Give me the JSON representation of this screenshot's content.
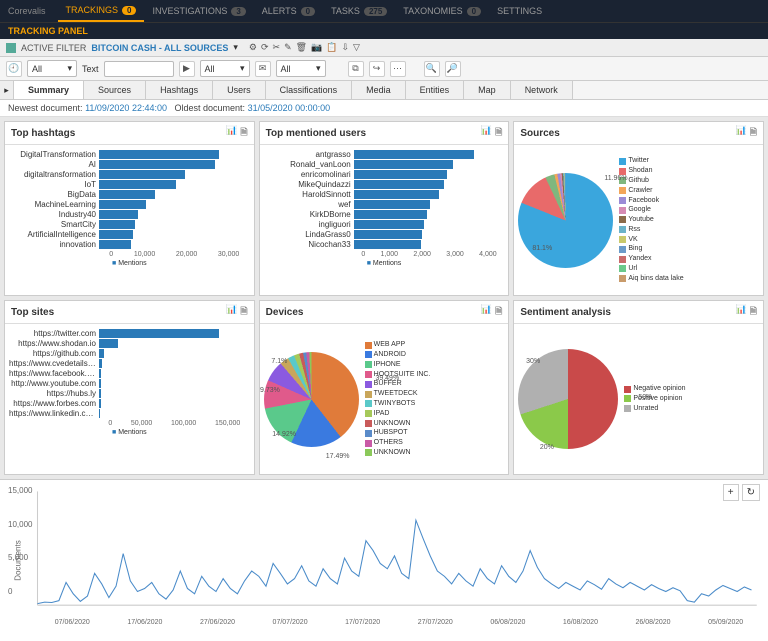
{
  "brand": "Corevalis",
  "nav": [
    {
      "label": "TRACKINGS",
      "badge": "0",
      "active": true
    },
    {
      "label": "INVESTIGATIONS",
      "badge": "3"
    },
    {
      "label": "ALERTS",
      "badge": "0"
    },
    {
      "label": "TASKS",
      "badge": "275"
    },
    {
      "label": "TAXONOMIES",
      "badge": "0"
    },
    {
      "label": "SETTINGS"
    }
  ],
  "panel_header": "TRACKING PANEL",
  "filter": {
    "label": "ACTIVE FILTER",
    "value": "BITCOIN CASH - ALL SOURCES"
  },
  "toolbar": {
    "sel_all": "All",
    "text_label": "Text",
    "text_value": "",
    "sel_all2": "All",
    "sel_all3": "All"
  },
  "tabs": [
    "Summary",
    "Sources",
    "Hashtags",
    "Users",
    "Classifications",
    "Media",
    "Entities",
    "Map",
    "Network"
  ],
  "active_tab": "Summary",
  "info": {
    "newest_lbl": "Newest document:",
    "newest": "11/09/2020 22:44:00",
    "oldest_lbl": "Oldest document:",
    "oldest": "31/05/2020 00:00:00"
  },
  "cards": {
    "hashtags": {
      "title": "Top hashtags",
      "legend": "Mentions"
    },
    "users": {
      "title": "Top mentioned users",
      "legend": "Mentions"
    },
    "sources": {
      "title": "Sources"
    },
    "sites": {
      "title": "Top sites",
      "legend": "Mentions"
    },
    "devices": {
      "title": "Devices"
    },
    "sentiment": {
      "title": "Sentiment analysis"
    }
  },
  "timeline": {
    "ylabel": "Documents"
  },
  "chart_data": [
    {
      "type": "bar",
      "id": "hashtags",
      "orientation": "h",
      "xlabel": "Mentions",
      "xticks": [
        0,
        10000,
        20000,
        30000
      ],
      "categories": [
        "DigitalTransformation",
        "AI",
        "digitaltransformation",
        "IoT",
        "BigData",
        "MachineLearning",
        "Industry40",
        "SmartCity",
        "ArtificialIntelligence",
        "innovation"
      ],
      "values": [
        28000,
        27000,
        20000,
        18000,
        13000,
        11000,
        9000,
        8500,
        8000,
        7500
      ]
    },
    {
      "type": "bar",
      "id": "users",
      "orientation": "h",
      "xlabel": "Mentions",
      "xticks": [
        0,
        1000,
        2000,
        3000,
        4000
      ],
      "categories": [
        "antgrasso",
        "Ronald_vanLoon",
        "enricomolinari",
        "MikeQuindazzi",
        "HaroldSinnott",
        "wef",
        "KirkDBorne",
        "ingliguori",
        "LindaGrass0",
        "Nicochan33"
      ],
      "values": [
        4100,
        3400,
        3200,
        3100,
        2900,
        2600,
        2500,
        2400,
        2350,
        2300
      ]
    },
    {
      "type": "pie",
      "id": "sources",
      "series": [
        {
          "name": "Twitter",
          "value": 81.1,
          "color": "#3aa6dd"
        },
        {
          "name": "Shodan",
          "value": 11.96,
          "color": "#e86a6a"
        },
        {
          "name": "Github",
          "value": 3.15,
          "color": "#7fb77e"
        },
        {
          "name": "Crawler",
          "value": 0.99,
          "color": "#f2a65a"
        },
        {
          "name": "Facebook",
          "value": 0.92,
          "color": "#9b8bd6"
        },
        {
          "name": "Google",
          "value": 0.59,
          "color": "#d68bb3"
        },
        {
          "name": "Youtube",
          "value": 0.49,
          "color": "#8b6b4a"
        },
        {
          "name": "Rss",
          "value": 0.41,
          "color": "#6bb3c9"
        },
        {
          "name": "VK",
          "value": 0.17,
          "color": "#c9c96b"
        },
        {
          "name": "Bing",
          "value": 0.16,
          "color": "#6b9bc9"
        },
        {
          "name": "Yandex",
          "value": 0.04,
          "color": "#c96b6b"
        },
        {
          "name": "Url",
          "value": 0.01,
          "color": "#6bc98b"
        },
        {
          "name": "Aiq bins data lake",
          "value": 0.01,
          "color": "#c99b6b"
        }
      ]
    },
    {
      "type": "bar",
      "id": "sites",
      "orientation": "h",
      "xlabel": "Mentions",
      "xticks": [
        0,
        50000,
        100000,
        150000
      ],
      "categories": [
        "https://twitter.com",
        "https://www.shodan.io",
        "https://github.com",
        "https://www.cvedetails.com",
        "https://www.facebook.com",
        "http://www.youtube.com",
        "https://hubs.ly",
        "https://www.forbes.com",
        "https://www.linkedin.com"
      ],
      "values": [
        140000,
        22000,
        6000,
        3000,
        2500,
        2200,
        2000,
        1800,
        1700
      ]
    },
    {
      "type": "pie",
      "id": "devices",
      "series": [
        {
          "name": "WEB APP",
          "value": 39.49,
          "color": "#e07b3a"
        },
        {
          "name": "ANDROID",
          "value": 17.49,
          "color": "#3a7ae0"
        },
        {
          "name": "IPHONE",
          "value": 14.92,
          "color": "#5ac98b"
        },
        {
          "name": "HOOTSUITE INC.",
          "value": 9.73,
          "color": "#e05a8b"
        },
        {
          "name": "BUFFER",
          "value": 7.1,
          "color": "#8b5ae0"
        },
        {
          "name": "TWEETDECK",
          "value": 3.02,
          "color": "#c9a65a"
        },
        {
          "name": "TWINYBOTS",
          "value": 2.23,
          "color": "#5ac9c9"
        },
        {
          "name": "IPAD",
          "value": 1.83,
          "color": "#a6c95a"
        },
        {
          "name": "UNKNOWN",
          "value": 1.35,
          "color": "#c95a5a"
        },
        {
          "name": "HUBSPOT",
          "value": 1.05,
          "color": "#5a8bc9"
        },
        {
          "name": "OTHERS",
          "value": 1.03,
          "color": "#c95aa6"
        },
        {
          "name": "UNKNOWN",
          "value": 0.76,
          "color": "#8bc95a"
        }
      ]
    },
    {
      "type": "pie",
      "id": "sentiment",
      "series": [
        {
          "name": "Negative opinion",
          "value": 50,
          "color": "#c94a4a"
        },
        {
          "name": "Positive opinion",
          "value": 20,
          "color": "#8bc94a"
        },
        {
          "name": "Unrated",
          "value": 30,
          "color": "#b0b0b0"
        }
      ]
    },
    {
      "type": "line",
      "id": "timeline",
      "ylabel": "Documents",
      "ylim": [
        0,
        15000
      ],
      "xticks": [
        "07/06/2020",
        "17/06/2020",
        "27/06/2020",
        "07/07/2020",
        "17/07/2020",
        "27/07/2020",
        "06/08/2020",
        "16/08/2020",
        "26/08/2020",
        "05/09/2020"
      ],
      "values": [
        200,
        400,
        350,
        600,
        3000,
        1500,
        500,
        1200,
        4200,
        2800,
        1000,
        2500,
        6800,
        3200,
        1800,
        2200,
        3000,
        1500,
        800,
        2000,
        4500,
        2200,
        1500,
        3800,
        2500,
        1800,
        3500,
        2200,
        1500,
        3200,
        4500,
        3800,
        2500,
        5500,
        4200,
        2800,
        3500,
        5200,
        3200,
        2500,
        4800,
        3500,
        2800,
        6200,
        4500,
        3800,
        8500,
        7200,
        5500,
        4800,
        6500,
        4200,
        3500,
        11200,
        8800,
        6500,
        4500,
        3800,
        2800,
        4200,
        3200,
        2500,
        4800,
        3500,
        2800,
        5200,
        3800,
        3000,
        4500,
        7200,
        5000,
        3500,
        2800,
        2200,
        3000,
        2500,
        2000,
        3200,
        2700,
        2100,
        3500,
        2800,
        2300,
        3000,
        2500,
        2000,
        2700,
        2200,
        1800,
        2300,
        1900,
        600,
        400,
        1500,
        1200,
        2000,
        2600,
        2200,
        1800,
        2400,
        2000
      ]
    }
  ]
}
